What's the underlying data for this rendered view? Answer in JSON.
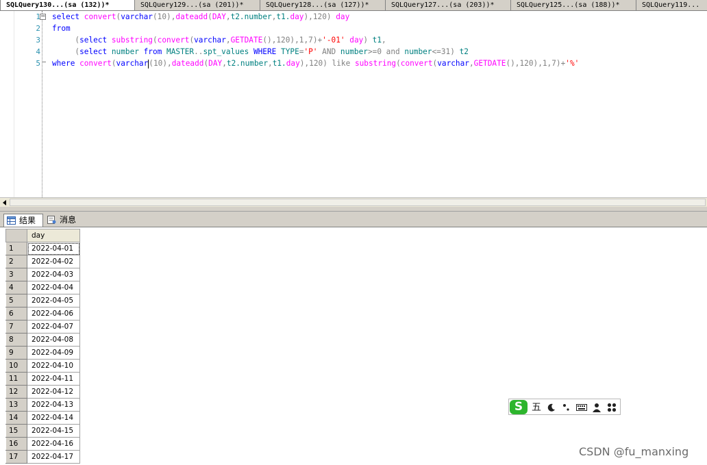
{
  "tabs": [
    {
      "label": "SQLQuery130...(sa (132))*",
      "active": true
    },
    {
      "label": "SQLQuery129...(sa (201))*",
      "active": false
    },
    {
      "label": "SQLQuery128...(sa (127))*",
      "active": false
    },
    {
      "label": "SQLQuery127...(sa (203))*",
      "active": false
    },
    {
      "label": "SQLQuery125...(sa (188))*",
      "active": false
    },
    {
      "label": "SQLQuery119...",
      "active": false
    }
  ],
  "editor": {
    "line_numbers": [
      "1",
      "2",
      "3",
      "4",
      "5"
    ],
    "lines": [
      [
        [
          "k",
          "select "
        ],
        [
          "f",
          "convert"
        ],
        [
          "g",
          "("
        ],
        [
          "k",
          "varchar"
        ],
        [
          "g",
          "(10),"
        ],
        [
          "f",
          "dateadd"
        ],
        [
          "g",
          "("
        ],
        [
          "f",
          "DAY"
        ],
        [
          "g",
          ","
        ],
        [
          "t",
          "t2.number"
        ],
        [
          "g",
          ","
        ],
        [
          "t",
          "t1."
        ],
        [
          "f",
          "day"
        ],
        [
          "g",
          "),120) "
        ],
        [
          "f",
          "day"
        ]
      ],
      [
        [
          "k",
          "from"
        ]
      ],
      [
        [
          "b",
          "     "
        ],
        [
          "g",
          "("
        ],
        [
          "k",
          "select "
        ],
        [
          "f",
          "substring"
        ],
        [
          "g",
          "("
        ],
        [
          "f",
          "convert"
        ],
        [
          "g",
          "("
        ],
        [
          "k",
          "varchar"
        ],
        [
          "g",
          ","
        ],
        [
          "f",
          "GETDATE"
        ],
        [
          "g",
          "(),120),1,7)+"
        ],
        [
          "s",
          "'-01'"
        ],
        [
          "g",
          " "
        ],
        [
          "f",
          "day"
        ],
        [
          "g",
          ") "
        ],
        [
          "t",
          "t1"
        ],
        [
          "g",
          ","
        ]
      ],
      [
        [
          "b",
          "     "
        ],
        [
          "g",
          "("
        ],
        [
          "k",
          "select "
        ],
        [
          "t",
          "number "
        ],
        [
          "k",
          "from "
        ],
        [
          "t",
          "MASTER"
        ],
        [
          "g",
          ".."
        ],
        [
          "t",
          "spt_values "
        ],
        [
          "k",
          "WHERE "
        ],
        [
          "t",
          "TYPE"
        ],
        [
          "g",
          "="
        ],
        [
          "s",
          "'P'"
        ],
        [
          "g",
          " AND "
        ],
        [
          "t",
          "number"
        ],
        [
          "g",
          ">=0 and "
        ],
        [
          "t",
          "number"
        ],
        [
          "g",
          "<=31) "
        ],
        [
          "t",
          "t2"
        ]
      ],
      [
        [
          "k",
          "where "
        ],
        [
          "f",
          "convert"
        ],
        [
          "g",
          "("
        ],
        [
          "k",
          "varchar"
        ],
        [
          "cursor",
          ""
        ],
        [
          "g",
          "(10),"
        ],
        [
          "f",
          "dateadd"
        ],
        [
          "g",
          "("
        ],
        [
          "f",
          "DAY"
        ],
        [
          "g",
          ","
        ],
        [
          "t",
          "t2.number"
        ],
        [
          "g",
          ","
        ],
        [
          "t",
          "t1."
        ],
        [
          "f",
          "day"
        ],
        [
          "g",
          "),120) like "
        ],
        [
          "f",
          "substring"
        ],
        [
          "g",
          "("
        ],
        [
          "f",
          "convert"
        ],
        [
          "g",
          "("
        ],
        [
          "k",
          "varchar"
        ],
        [
          "g",
          ","
        ],
        [
          "f",
          "GETDATE"
        ],
        [
          "g",
          "(),120),1,7)+"
        ],
        [
          "s",
          "'%'"
        ]
      ]
    ]
  },
  "results_tabs": [
    {
      "label": "结果",
      "icon": "grid-icon",
      "active": true
    },
    {
      "label": "消息",
      "icon": "message-icon",
      "active": false
    }
  ],
  "grid": {
    "column": "day",
    "rows": [
      {
        "n": "1",
        "day": "2022-04-01"
      },
      {
        "n": "2",
        "day": "2022-04-02"
      },
      {
        "n": "3",
        "day": "2022-04-03"
      },
      {
        "n": "4",
        "day": "2022-04-04"
      },
      {
        "n": "5",
        "day": "2022-04-05"
      },
      {
        "n": "6",
        "day": "2022-04-06"
      },
      {
        "n": "7",
        "day": "2022-04-07"
      },
      {
        "n": "8",
        "day": "2022-04-08"
      },
      {
        "n": "9",
        "day": "2022-04-09"
      },
      {
        "n": "10",
        "day": "2022-04-10"
      },
      {
        "n": "11",
        "day": "2022-04-11"
      },
      {
        "n": "12",
        "day": "2022-04-12"
      },
      {
        "n": "13",
        "day": "2022-04-13"
      },
      {
        "n": "14",
        "day": "2022-04-14"
      },
      {
        "n": "15",
        "day": "2022-04-15"
      },
      {
        "n": "16",
        "day": "2022-04-16"
      },
      {
        "n": "17",
        "day": "2022-04-17"
      }
    ]
  },
  "ime": {
    "logo": "S",
    "mode": "五",
    "items": [
      "moon-icon",
      "punctuation-icon",
      "keyboard-icon",
      "user-icon",
      "grid-apps-icon"
    ]
  },
  "watermark": "CSDN @fu_manxing"
}
